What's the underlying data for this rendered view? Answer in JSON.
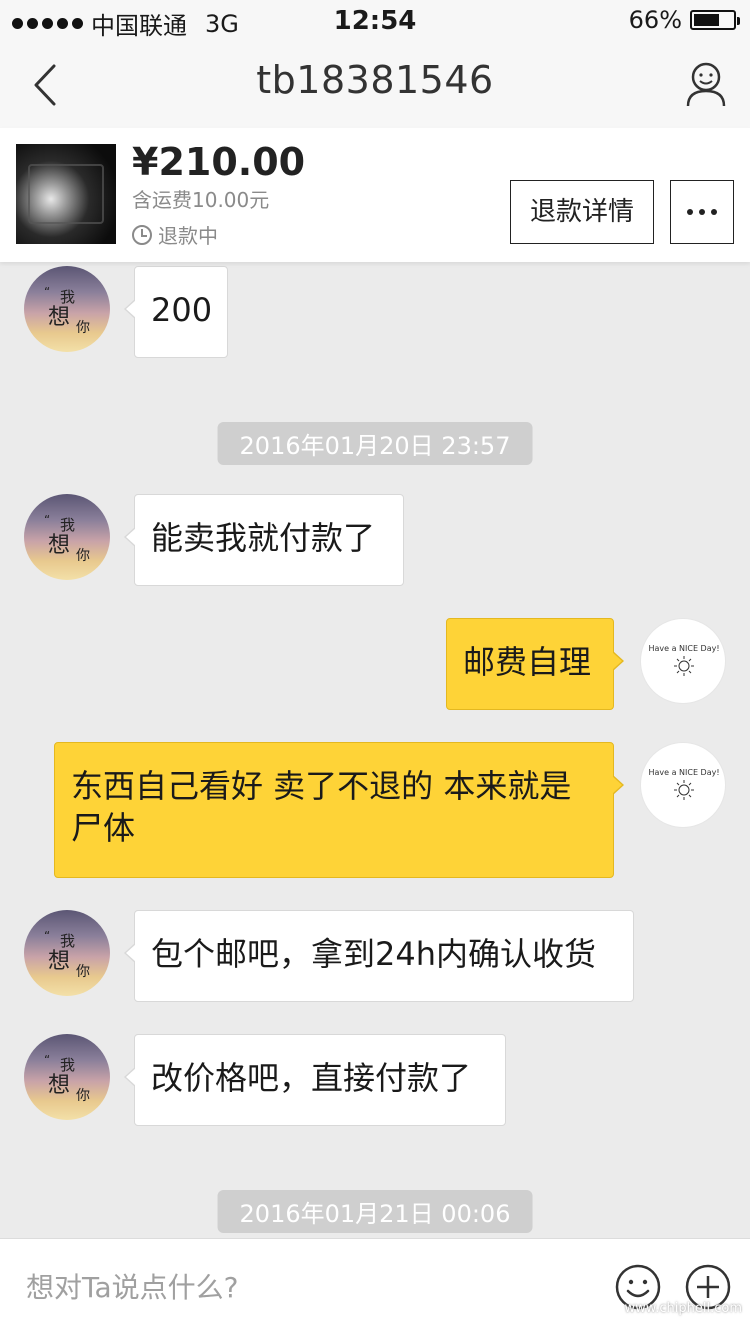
{
  "status_bar": {
    "carrier": "中国联通",
    "network": "3G",
    "time": "12:54",
    "battery_percent": "66%",
    "battery_level": 0.66
  },
  "nav": {
    "title": "tb18381546",
    "back_icon": "chevron-left-icon",
    "profile_icon": "user-profile-icon"
  },
  "order": {
    "price": "¥210.00",
    "shipping": "含运费10.00元",
    "status": "退款中",
    "refund_details_label": "退款详情",
    "more_icon": "more-icon"
  },
  "messages": [
    {
      "side": "left",
      "text": "200"
    },
    {
      "timestamp": "2016年01月20日 23:57"
    },
    {
      "side": "left",
      "text": "能卖我就付款了"
    },
    {
      "side": "right",
      "text": "邮费自理"
    },
    {
      "side": "right",
      "text": "东西自己看好 卖了不退的 本来就是尸体"
    },
    {
      "side": "left",
      "text": "包个邮吧，拿到24h内确认收货"
    },
    {
      "side": "left",
      "text": "改价格吧，直接付款了"
    },
    {
      "timestamp": "2016年01月21日 00:06"
    }
  ],
  "avatars": {
    "other_text": [
      "我",
      "想",
      "你"
    ],
    "self_text": "Have a NICE Day!"
  },
  "input": {
    "placeholder": "想对Ta说点什么?",
    "emoji_icon": "emoji-icon",
    "plus_icon": "plus-icon"
  },
  "watermark": "www.chiphell.com",
  "colors": {
    "accent_yellow": "#fed337",
    "background": "#ebebeb",
    "timestamp_bg": "#cfcfcf"
  }
}
